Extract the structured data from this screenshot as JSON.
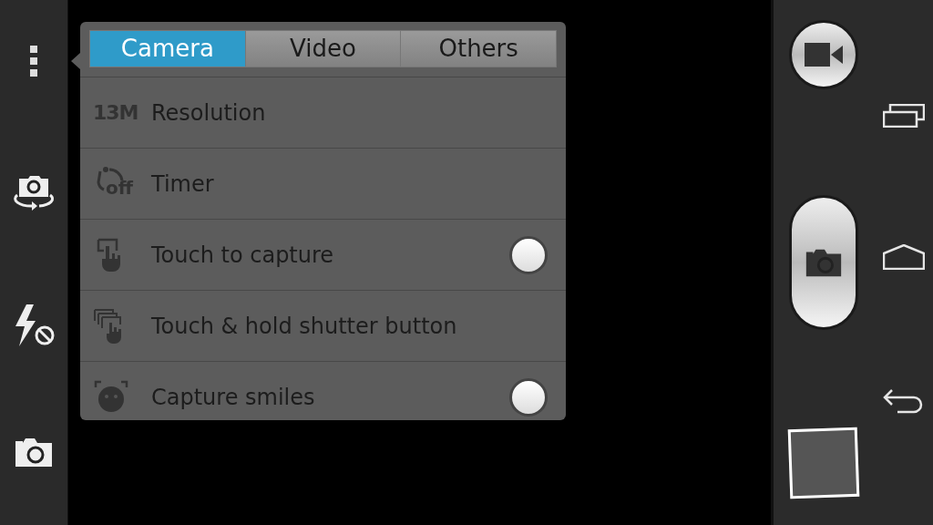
{
  "tabs": [
    {
      "label": "Camera",
      "selected": true
    },
    {
      "label": "Video",
      "selected": false
    },
    {
      "label": "Others",
      "selected": false
    }
  ],
  "settings": [
    {
      "kind": "value",
      "badge": "13M",
      "label": "Resolution"
    },
    {
      "kind": "timer",
      "badge": "off",
      "label": "Timer"
    },
    {
      "kind": "touch",
      "label": "Touch to capture",
      "on": false
    },
    {
      "kind": "burst",
      "label": "Touch & hold shutter button"
    },
    {
      "kind": "smile",
      "label": "Capture smiles",
      "on": false
    }
  ]
}
